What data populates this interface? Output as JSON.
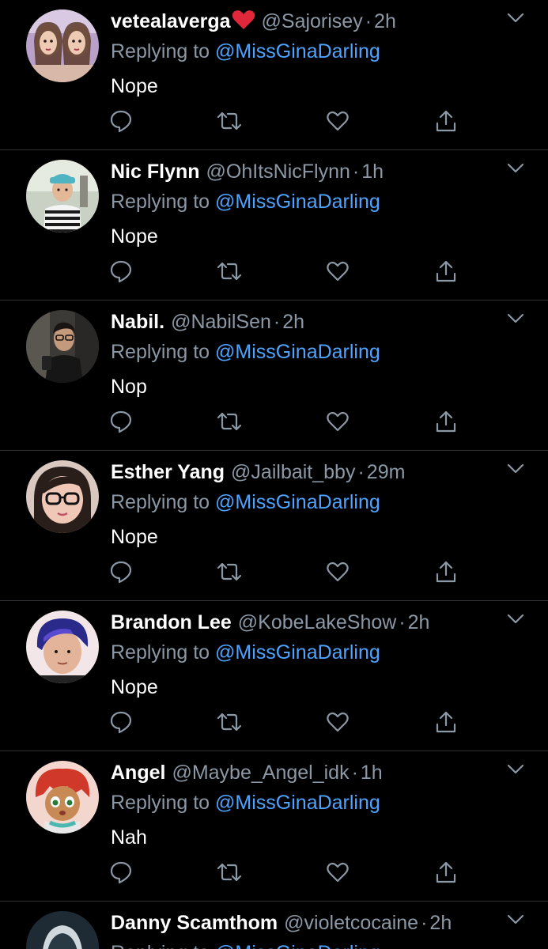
{
  "theme": {
    "background": "#000000",
    "divider": "#2f3336",
    "secondary_text": "#8b98a5",
    "link": "#4da3ff",
    "icon": "#8b98a5"
  },
  "reply_prefix": "Replying to",
  "tweets": [
    {
      "name": "vetealaverga",
      "has_heart_emoji": true,
      "handle": "@Sajorisey",
      "dot": "·",
      "time": "2h",
      "reply_to": "@MissGinaDarling",
      "text": "Nope",
      "avatar_icon": "avatar-two-women-photo"
    },
    {
      "name": "Nic Flynn",
      "has_heart_emoji": false,
      "handle": "@OhItsNicFlynn",
      "dot": "·",
      "time": "1h",
      "reply_to": "@MissGinaDarling",
      "text": "Nope",
      "avatar_icon": "avatar-man-striped-shirt-photo"
    },
    {
      "name": "Nabil.",
      "has_heart_emoji": false,
      "handle": "@NabilSen",
      "dot": "·",
      "time": "2h",
      "reply_to": "@MissGinaDarling",
      "text": "Nop",
      "avatar_icon": "avatar-man-mirror-selfie-photo"
    },
    {
      "name": "Esther Yang",
      "has_heart_emoji": false,
      "handle": "@Jailbait_bby",
      "dot": "·",
      "time": "29m",
      "reply_to": "@MissGinaDarling",
      "text": "Nope",
      "avatar_icon": "avatar-woman-glasses-photo"
    },
    {
      "name": "Brandon Lee",
      "has_heart_emoji": false,
      "handle": "@KobeLakeShow",
      "dot": "·",
      "time": "2h",
      "reply_to": "@MissGinaDarling",
      "text": "Nope",
      "avatar_icon": "avatar-man-blue-hair-photo"
    },
    {
      "name": "Angel",
      "has_heart_emoji": false,
      "handle": "@Maybe_Angel_idk",
      "dot": "·",
      "time": "1h",
      "reply_to": "@MissGinaDarling",
      "text": "Nah",
      "avatar_icon": "avatar-anime-character"
    },
    {
      "name": "Danny Scamthom",
      "has_heart_emoji": false,
      "handle": "@violetcocaine",
      "dot": "·",
      "time": "2h",
      "reply_to": "@MissGinaDarling",
      "text": "",
      "avatar_icon": "avatar-cartoon-character"
    }
  ],
  "actions": [
    "reply-icon",
    "retweet-icon",
    "like-icon",
    "share-icon"
  ]
}
